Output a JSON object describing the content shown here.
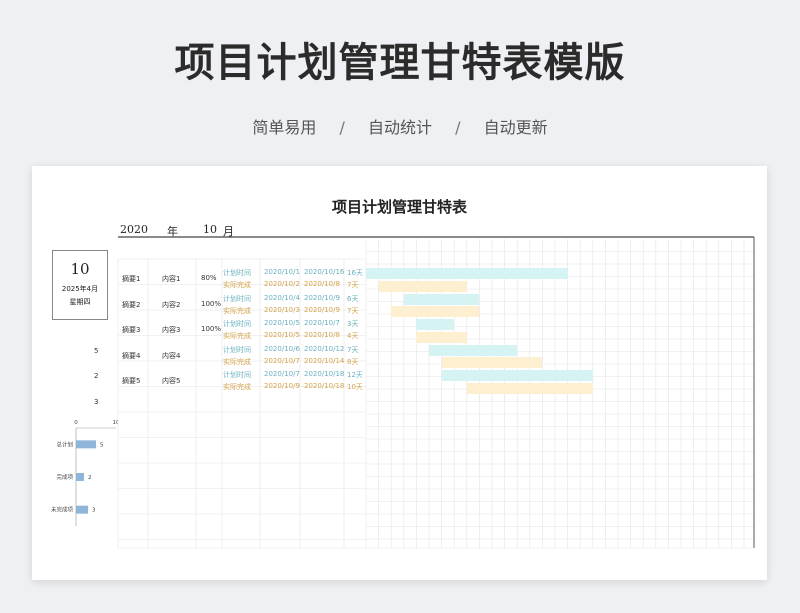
{
  "header": {
    "title": "项目计划管理甘特表模版",
    "features": [
      "简单易用",
      "自动统计",
      "自动更新"
    ],
    "separator": "/"
  },
  "sheet": {
    "title": "项目计划管理甘特表",
    "year": "2020",
    "year_unit": "年",
    "month": "10",
    "month_unit": "月",
    "date_box": {
      "day": "10",
      "year_month": "2025年4月",
      "weekday": "星期四"
    },
    "side_counts": [
      "5",
      "2",
      "3"
    ],
    "plan_label": "计划时间",
    "actual_label": "实际完成",
    "tasks": [
      {
        "summary": "摘要1",
        "content": "内容1",
        "progress": "80%",
        "plan": {
          "start": "2020/10/1",
          "end": "2020/10/16",
          "days": "16天",
          "s": 1,
          "e": 16
        },
        "actual": {
          "start": "2020/10/2",
          "end": "2020/10/8",
          "days": "7天",
          "s": 2,
          "e": 8
        }
      },
      {
        "summary": "摘要2",
        "content": "内容2",
        "progress": "100%",
        "plan": {
          "start": "2020/10/4",
          "end": "2020/10/9",
          "days": "6天",
          "s": 4,
          "e": 9
        },
        "actual": {
          "start": "2020/10/3",
          "end": "2020/10/9",
          "days": "7天",
          "s": 3,
          "e": 9
        }
      },
      {
        "summary": "摘要3",
        "content": "内容3",
        "progress": "100%",
        "plan": {
          "start": "2020/10/5",
          "end": "2020/10/7",
          "days": "3天",
          "s": 5,
          "e": 7
        },
        "actual": {
          "start": "2020/10/5",
          "end": "2020/10/8",
          "days": "4天",
          "s": 5,
          "e": 8
        }
      },
      {
        "summary": "摘要4",
        "content": "内容4",
        "progress": "",
        "plan": {
          "start": "2020/10/6",
          "end": "2020/10/12",
          "days": "7天",
          "s": 6,
          "e": 12
        },
        "actual": {
          "start": "2020/10/7",
          "end": "2020/10/14",
          "days": "8天",
          "s": 7,
          "e": 14
        }
      },
      {
        "summary": "摘要5",
        "content": "内容5",
        "progress": "",
        "plan": {
          "start": "2020/10/7",
          "end": "2020/10/18",
          "days": "12天",
          "s": 7,
          "e": 18
        },
        "actual": {
          "start": "2020/10/9",
          "end": "2020/10/18",
          "days": "10天",
          "s": 9,
          "e": 18
        }
      }
    ],
    "colors": {
      "plan_bar": "#d6f3f3",
      "actual_bar": "#fdefcf",
      "mini_bar": "#8fb6d8",
      "grid": "#e4e4e4"
    }
  },
  "chart_data": {
    "type": "bar",
    "orientation": "horizontal",
    "categories": [
      "总计划",
      "完成项",
      "未完成项"
    ],
    "values": [
      5,
      2,
      3
    ],
    "xlim": [
      0,
      10
    ],
    "xticks": [
      "0",
      "10"
    ]
  }
}
